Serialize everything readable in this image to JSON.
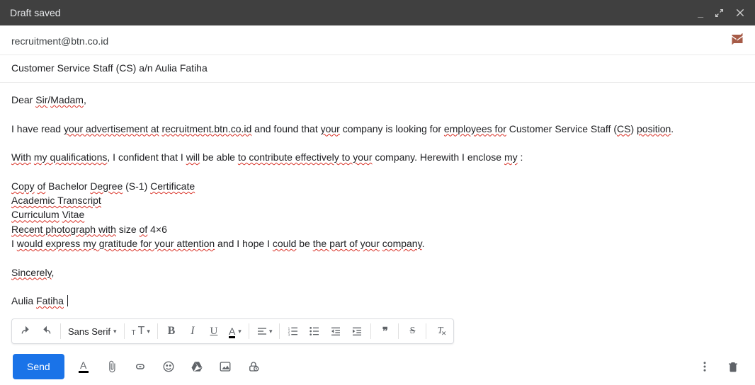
{
  "titlebar": {
    "title": "Draft saved"
  },
  "to": {
    "address": "recruitment@btn.co.id"
  },
  "subject": {
    "text": "Customer Service Staff (CS) a/n Aulia Fatiha"
  },
  "body": {
    "l1a": "Dear",
    "l1b": "Sir",
    "l1c": "/",
    "l1d": "Madam",
    "l1e": ",",
    "l2a": "I have read ",
    "l2b": "your advertisement at",
    "l2c": "  ",
    "l2d": "recruitment.btn.co.id",
    "l2e": "  and found that ",
    "l2f": "your",
    "l2g": " company is looking for ",
    "l2h": "employees for",
    "l2i": " Customer Service Staff (",
    "l2j": "CS",
    "l2k": ") ",
    "l2l": "position",
    "l2m": ".",
    "l3a": "With",
    "l3b": " ",
    "l3c": "my qualifications",
    "l3d": ", I confident that I ",
    "l3e": "will",
    "l3f": " be able ",
    "l3g": "to contribute effectively to your",
    "l3h": " company. Herewith I enclose ",
    "l3i": "my",
    "l3j": " :",
    "l4a": "Copy",
    "l4b": " ",
    "l4c": "of",
    "l4d": " Bachelor ",
    "l4e": "Degree",
    "l4f": " (S-1) ",
    "l4g": "Certificate",
    "l5a": "Academic Transcript",
    "l6a": "Curriculum",
    "l6b": " ",
    "l6c": "Vitae",
    "l7a": "Recent photograph with",
    "l7b": " size ",
    "l7c": "of",
    "l7d": " 4×6",
    "l8a": "I ",
    "l8b": "would express my gratitude for your attention",
    "l8c": " and I hope I ",
    "l8d": "could",
    "l8e": " be ",
    "l8f": "the part of your",
    "l8g": " ",
    "l8h": "company",
    "l8i": ".",
    "l9a": "Sincerely",
    "l9b": ",",
    "l10a": "Aulia ",
    "l10b": "Fatiha"
  },
  "toolbar": {
    "fontname": "Sans Serif",
    "size_small": "T",
    "size_big": "T"
  },
  "send": {
    "label": "Send"
  }
}
